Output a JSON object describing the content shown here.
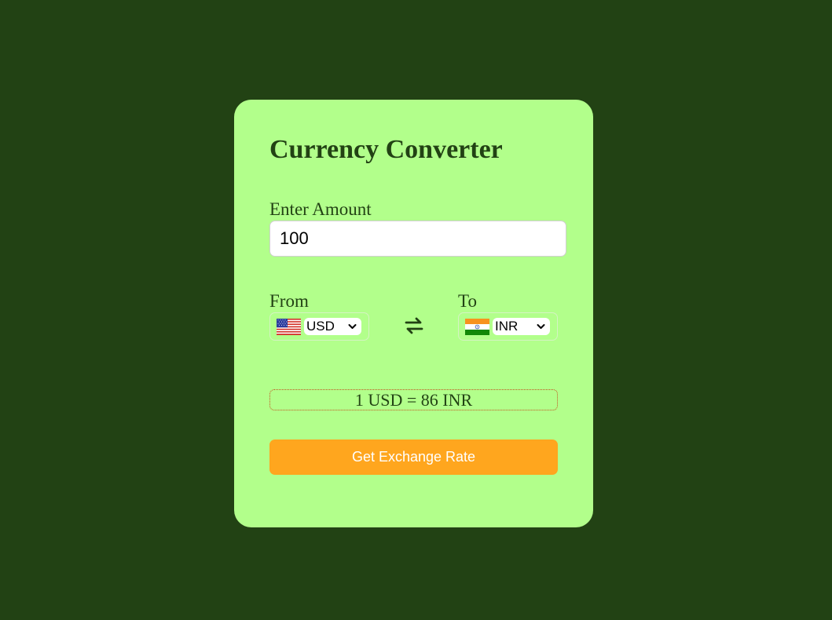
{
  "converter": {
    "title": "Currency Converter",
    "amount_label": "Enter Amount",
    "amount_value": "100",
    "from_label": "From",
    "from_currency": "USD",
    "from_flag": "us-flag-icon",
    "swap_icon": "swap-arrows-icon",
    "to_label": "To",
    "to_currency": "INR",
    "to_flag": "india-flag-icon",
    "rate_text": "1 USD = 86 INR",
    "button_label": "Get Exchange Rate"
  },
  "colors": {
    "page_background": "#224214",
    "card_background": "#b2ff8b",
    "text": "#224214",
    "button": "#ffa61e",
    "button_text": "#ffffff"
  }
}
